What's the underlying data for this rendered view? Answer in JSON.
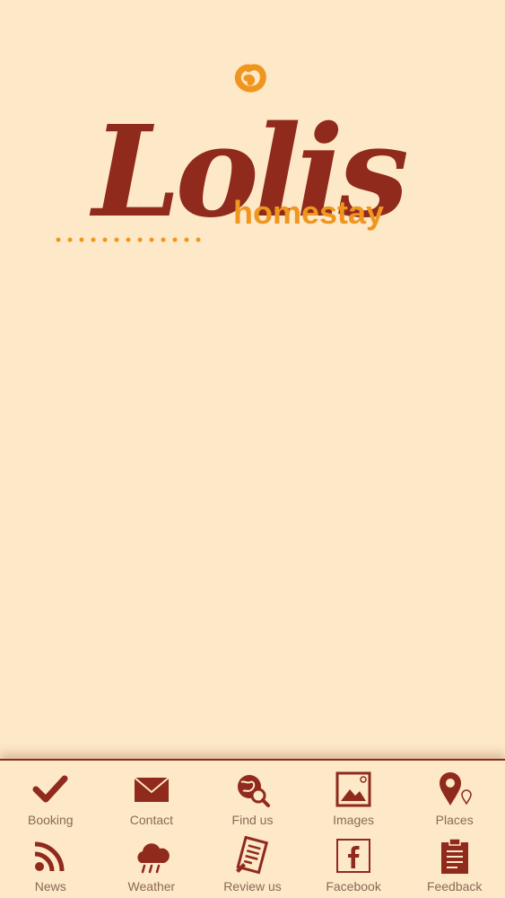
{
  "app": {
    "logo_primary": "Lolis",
    "logo_secondary": "homestay"
  },
  "colors": {
    "background": "#fde8c8",
    "brand_red": "#8f2a1c",
    "brand_orange": "#f0961e",
    "label_gray": "#8a6a55"
  },
  "nav": {
    "row1": [
      {
        "label": "Booking",
        "icon": "checkmark-icon"
      },
      {
        "label": "Contact",
        "icon": "envelope-icon"
      },
      {
        "label": "Find us",
        "icon": "globe-search-icon"
      },
      {
        "label": "Images",
        "icon": "image-icon"
      },
      {
        "label": "Places",
        "icon": "map-pin-icon"
      }
    ],
    "row2": [
      {
        "label": "News",
        "icon": "rss-icon"
      },
      {
        "label": "Weather",
        "icon": "weather-cloud-icon"
      },
      {
        "label": "Review us",
        "icon": "review-document-icon"
      },
      {
        "label": "Facebook",
        "icon": "facebook-icon"
      },
      {
        "label": "Feedback",
        "icon": "clipboard-icon"
      }
    ]
  }
}
